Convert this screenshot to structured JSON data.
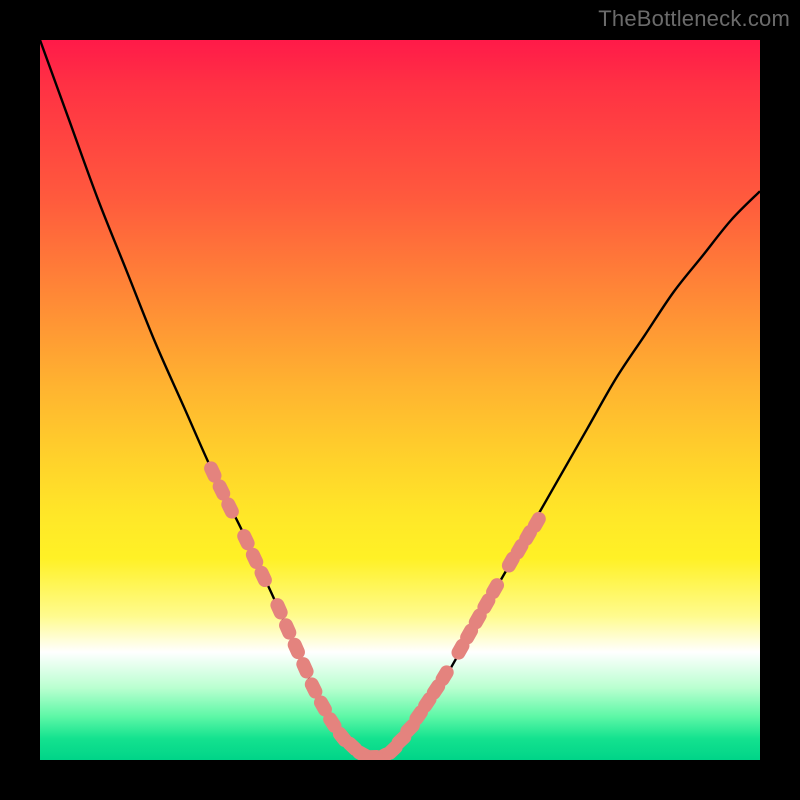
{
  "watermark": "TheBottleneck.com",
  "colors": {
    "curve_stroke": "#000000",
    "marker_fill": "#e4837e",
    "frame_bg": "#000000",
    "gradient_top": "#ff1a49",
    "gradient_bottom": "#00d488"
  },
  "chart_data": {
    "type": "line",
    "title": "",
    "xlabel": "",
    "ylabel": "",
    "xlim": [
      0,
      100
    ],
    "ylim": [
      0,
      100
    ],
    "grid": false,
    "legend": false,
    "series": [
      {
        "name": "bottleneck-curve",
        "x": [
          0,
          4,
          8,
          12,
          16,
          20,
          24,
          28,
          32,
          34,
          36,
          38,
          40,
          42,
          44,
          46,
          48,
          52,
          56,
          60,
          64,
          68,
          72,
          76,
          80,
          84,
          88,
          92,
          96,
          100
        ],
        "y": [
          100,
          89,
          78,
          68,
          58,
          49,
          40,
          32,
          23.5,
          19,
          14.5,
          10,
          6.5,
          3.5,
          1.5,
          0.4,
          1.2,
          5,
          11,
          18,
          25,
          32,
          39,
          46,
          53,
          59,
          65,
          70,
          75,
          79
        ]
      }
    ],
    "annotations": {
      "markers_left": [
        {
          "x": 24.0,
          "y": 40.0
        },
        {
          "x": 25.2,
          "y": 37.5
        },
        {
          "x": 26.4,
          "y": 35.0
        },
        {
          "x": 28.6,
          "y": 30.6
        },
        {
          "x": 29.8,
          "y": 28.0
        },
        {
          "x": 31.0,
          "y": 25.5
        },
        {
          "x": 33.2,
          "y": 21.0
        },
        {
          "x": 34.4,
          "y": 18.2
        },
        {
          "x": 35.6,
          "y": 15.5
        },
        {
          "x": 36.8,
          "y": 12.8
        },
        {
          "x": 38.0,
          "y": 10.0
        },
        {
          "x": 39.3,
          "y": 7.5
        },
        {
          "x": 40.6,
          "y": 5.2
        }
      ],
      "markers_bottom": [
        {
          "x": 42.0,
          "y": 3.2
        },
        {
          "x": 43.4,
          "y": 1.9
        },
        {
          "x": 44.8,
          "y": 0.8
        },
        {
          "x": 46.2,
          "y": 0.4
        },
        {
          "x": 47.6,
          "y": 0.5
        },
        {
          "x": 49.0,
          "y": 1.4
        }
      ],
      "markers_right": [
        {
          "x": 50.2,
          "y": 2.8
        },
        {
          "x": 51.4,
          "y": 4.4
        },
        {
          "x": 52.6,
          "y": 6.2
        },
        {
          "x": 53.8,
          "y": 8.0
        },
        {
          "x": 55.0,
          "y": 9.8
        },
        {
          "x": 56.2,
          "y": 11.7
        },
        {
          "x": 58.4,
          "y": 15.4
        },
        {
          "x": 59.6,
          "y": 17.5
        },
        {
          "x": 60.8,
          "y": 19.6
        },
        {
          "x": 62.0,
          "y": 21.7
        },
        {
          "x": 63.2,
          "y": 23.8
        },
        {
          "x": 65.4,
          "y": 27.5
        },
        {
          "x": 66.6,
          "y": 29.3
        },
        {
          "x": 67.8,
          "y": 31.2
        },
        {
          "x": 69.0,
          "y": 33.0
        }
      ]
    }
  }
}
